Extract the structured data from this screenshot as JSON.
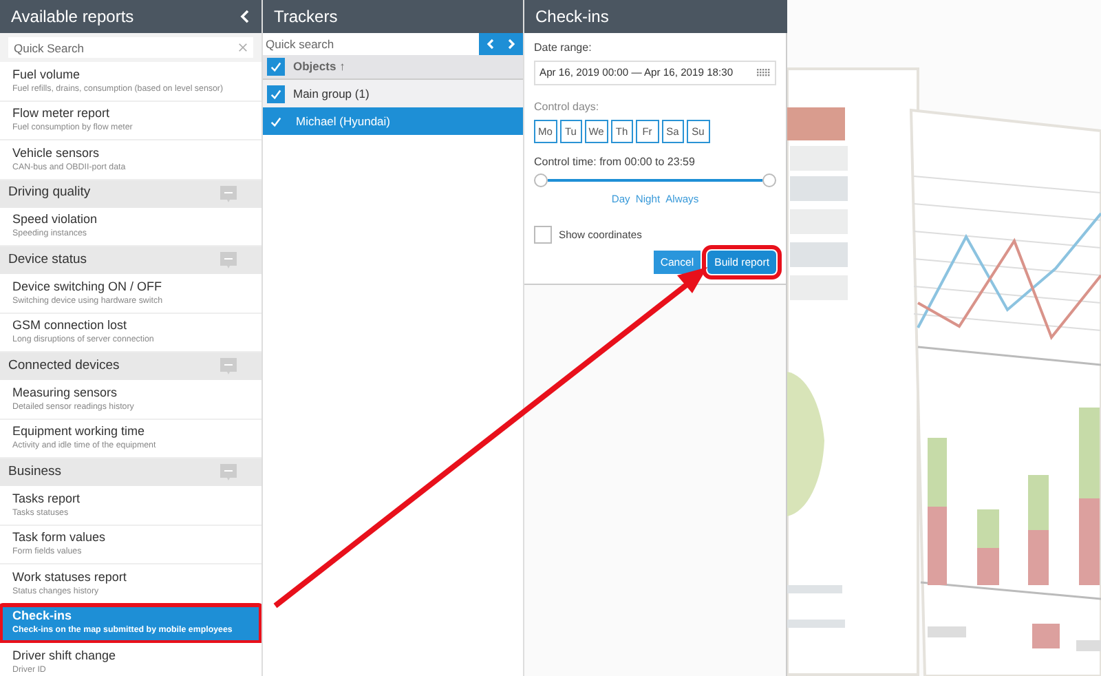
{
  "reports_panel": {
    "title": "Available reports",
    "search": {
      "placeholder": "Quick Search"
    },
    "entries": [
      {
        "kind": "item",
        "title": "Fuel volume",
        "subtitle": "Fuel refills, drains, consumption (based on level sensor)",
        "selected": false,
        "highlighted": false
      },
      {
        "kind": "item",
        "title": "Flow meter report",
        "subtitle": "Fuel consumption by flow meter",
        "selected": false,
        "highlighted": false
      },
      {
        "kind": "item",
        "title": "Vehicle sensors",
        "subtitle": "CAN-bus and OBDII-port data",
        "selected": false,
        "highlighted": false
      },
      {
        "kind": "category",
        "title": "Driving quality"
      },
      {
        "kind": "item",
        "title": "Speed violation",
        "subtitle": "Speeding instances",
        "selected": false,
        "highlighted": false
      },
      {
        "kind": "category",
        "title": "Device status"
      },
      {
        "kind": "item",
        "title": "Device switching ON / OFF",
        "subtitle": "Switching device using hardware switch",
        "selected": false,
        "highlighted": false
      },
      {
        "kind": "item",
        "title": "GSM connection lost",
        "subtitle": "Long disruptions of server connection",
        "selected": false,
        "highlighted": false
      },
      {
        "kind": "category",
        "title": "Connected devices"
      },
      {
        "kind": "item",
        "title": "Measuring sensors",
        "subtitle": "Detailed sensor readings history",
        "selected": false,
        "highlighted": false
      },
      {
        "kind": "item",
        "title": "Equipment working time",
        "subtitle": "Activity and idle time of the equipment",
        "selected": false,
        "highlighted": false
      },
      {
        "kind": "category",
        "title": "Business"
      },
      {
        "kind": "item",
        "title": "Tasks report",
        "subtitle": "Tasks statuses",
        "selected": false,
        "highlighted": false
      },
      {
        "kind": "item",
        "title": "Task form values",
        "subtitle": "Form fields values",
        "selected": false,
        "highlighted": false
      },
      {
        "kind": "item",
        "title": "Work statuses report",
        "subtitle": "Status changes history",
        "selected": false,
        "highlighted": false
      },
      {
        "kind": "item",
        "title": "Check-ins",
        "subtitle": "Check-ins on the map submitted by mobile employees",
        "selected": true,
        "highlighted": true
      },
      {
        "kind": "item",
        "title": "Driver shift change",
        "subtitle": "Driver ID",
        "selected": false,
        "highlighted": false
      }
    ]
  },
  "trackers_panel": {
    "title": "Trackers",
    "search": {
      "placeholder": "Quick search"
    },
    "header": {
      "label": "Objects",
      "sort_icon": "↑",
      "checked": true
    },
    "rows": [
      {
        "kind": "group",
        "label": "Main group (1)",
        "checked": true,
        "selected": false
      },
      {
        "kind": "tracker",
        "label": "Michael (Hyundai)",
        "checked": true,
        "selected": true
      }
    ]
  },
  "form_panel": {
    "title": "Check-ins",
    "date_range": {
      "label": "Date range:",
      "value": "Apr 16, 2019 00:00 — Apr 16, 2019 18:30"
    },
    "control_days": {
      "label": "Control days:",
      "days": [
        {
          "label": "Mo",
          "selected": false
        },
        {
          "label": "Tu",
          "selected": false
        },
        {
          "label": "We",
          "selected": false
        },
        {
          "label": "Th",
          "selected": false
        },
        {
          "label": "Fr",
          "selected": false
        },
        {
          "label": "Sa",
          "selected": false
        },
        {
          "label": "Su",
          "selected": false
        }
      ]
    },
    "control_time": {
      "label": "Control time: from 00:00 to 23:59",
      "thumbs": [
        {
          "level": 0
        },
        {
          "level": 1
        }
      ],
      "presets": [
        "Day",
        "Night",
        "Always"
      ]
    },
    "show_coordinates": {
      "label": "Show coordinates",
      "checked": false
    },
    "buttons": [
      {
        "kind": "secondary",
        "label": "Cancel",
        "highlighted": false
      },
      {
        "kind": "primary",
        "label": "Build report",
        "highlighted": true
      }
    ]
  }
}
